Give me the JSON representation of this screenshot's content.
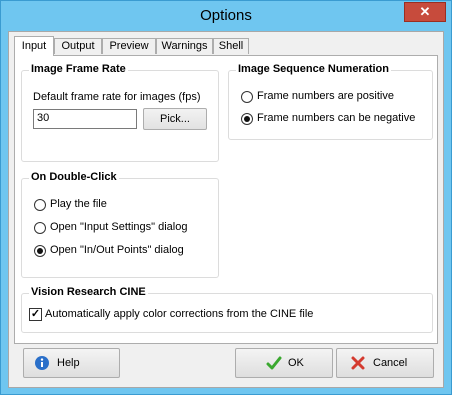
{
  "window": {
    "title": "Options",
    "close_glyph": "✕"
  },
  "tabs": [
    {
      "label": "Input",
      "active": true
    },
    {
      "label": "Output",
      "active": false
    },
    {
      "label": "Preview",
      "active": false
    },
    {
      "label": "Warnings",
      "active": false
    },
    {
      "label": "Shell",
      "active": false
    }
  ],
  "frame_rate": {
    "title": "Image Frame Rate",
    "label": "Default frame rate for images (fps)",
    "value": "30",
    "pick_button": "Pick..."
  },
  "sequence": {
    "title": "Image Sequence Numeration",
    "options": [
      {
        "label": "Frame numbers are positive",
        "selected": false
      },
      {
        "label": "Frame numbers can be negative",
        "selected": true
      }
    ]
  },
  "double_click": {
    "title": "On Double-Click",
    "options": [
      {
        "label": "Play the file",
        "selected": false
      },
      {
        "label": "Open \"Input Settings\" dialog",
        "selected": false
      },
      {
        "label": "Open \"In/Out Points\" dialog",
        "selected": true
      }
    ]
  },
  "cine": {
    "title": "Vision Research CINE",
    "checkbox_label": "Automatically apply color corrections from the CINE file",
    "checked": true
  },
  "buttons": {
    "help": "Help",
    "ok": "OK",
    "cancel": "Cancel"
  },
  "colors": {
    "title_bar": "#6fc6f0",
    "close_button": "#c74b3c",
    "help_icon": "#2a6fc9",
    "ok_icon": "#3aa82f",
    "cancel_icon": "#d43a2f"
  }
}
